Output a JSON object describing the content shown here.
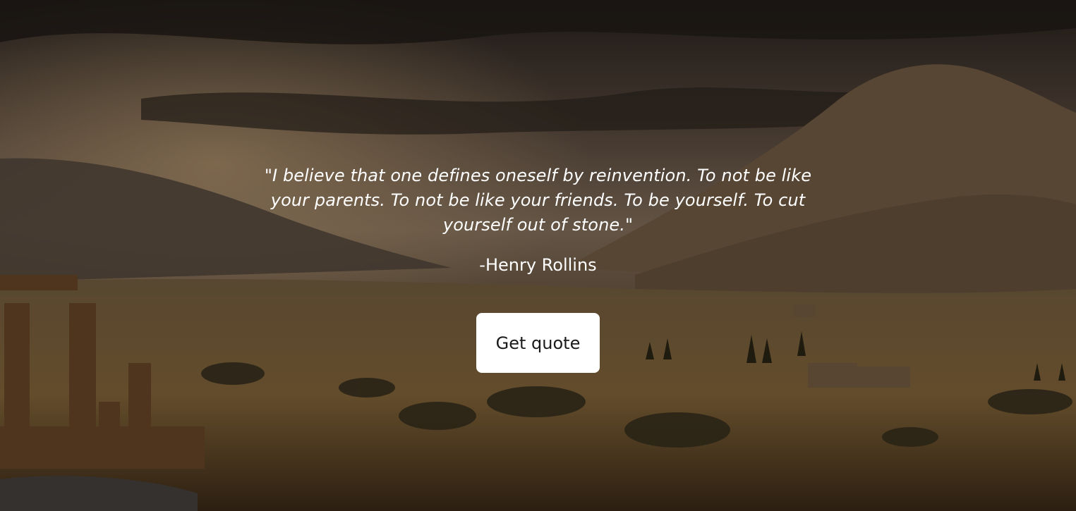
{
  "quote": {
    "text": "\"I believe that one defines oneself by reinvention. To not be like your parents. To not be like your friends. To be yourself. To cut yourself out of stone.\"",
    "author": "-Henry Rollins"
  },
  "actions": {
    "get_quote_label": "Get quote"
  },
  "background": {
    "scene": "ancient ruins in a mountain valley at sunset",
    "tint": "#3a2d22"
  }
}
